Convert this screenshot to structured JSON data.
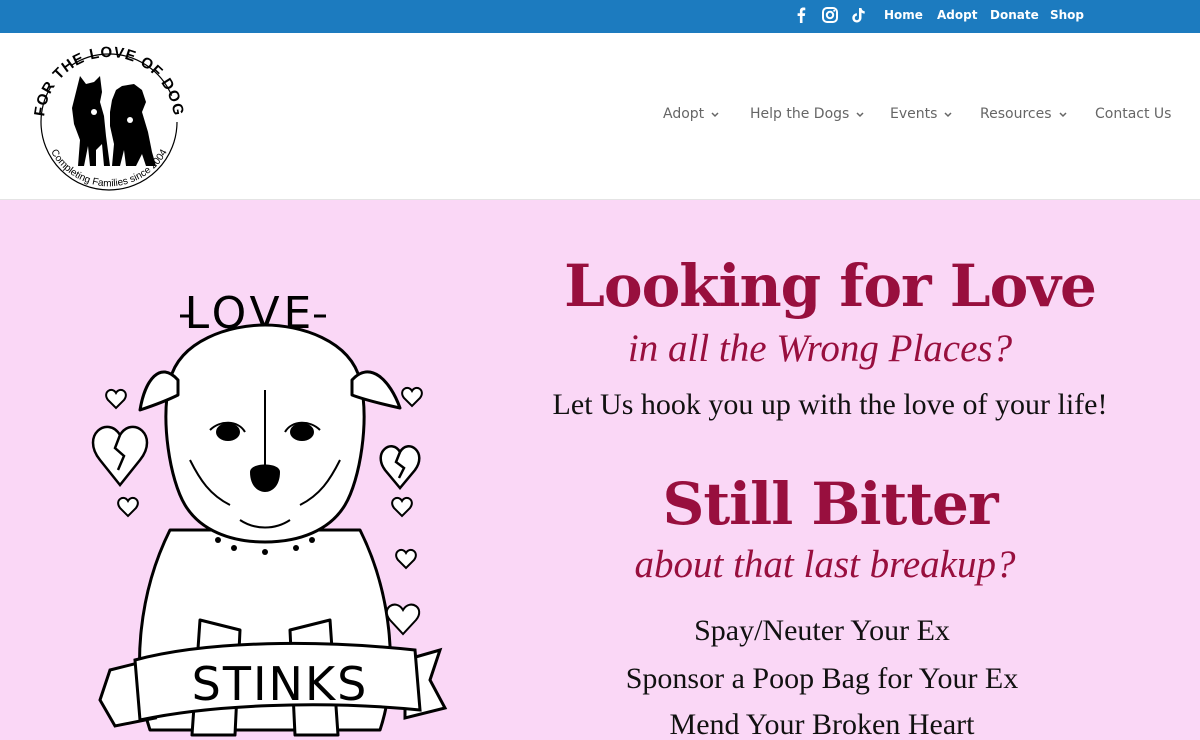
{
  "topbar": {
    "social": [
      {
        "icon": "facebook-icon"
      },
      {
        "icon": "instagram-icon"
      },
      {
        "icon": "tiktok-icon"
      }
    ],
    "links": [
      "Home",
      "Adopt",
      "Donate",
      "Shop"
    ],
    "color": "#1c7bbf"
  },
  "logo": {
    "arc_text": "FOR THE LOVE OF DOG",
    "tagline": "Completing Families since 2004"
  },
  "nav": {
    "items": [
      {
        "label": "Adopt",
        "has_dropdown": true
      },
      {
        "label": "Help the Dogs",
        "has_dropdown": true
      },
      {
        "label": "Events",
        "has_dropdown": true
      },
      {
        "label": "Resources",
        "has_dropdown": true
      },
      {
        "label": "Contact Us",
        "has_dropdown": false
      }
    ]
  },
  "hero": {
    "background": "#fad7f6",
    "accent": "#980f3e",
    "illustration": {
      "top_word": "LOVE",
      "banner_word": "STINKS"
    },
    "heading1": "Looking for Love",
    "subheading1": "in all the Wrong Places?",
    "line1": "Let Us hook you up with the love of your life!",
    "heading2": "Still Bitter",
    "subheading2": "about that last breakup?",
    "links": [
      "Spay/Neuter Your Ex",
      "Sponsor a Poop Bag for Your Ex",
      "Mend Your Broken Heart"
    ]
  }
}
